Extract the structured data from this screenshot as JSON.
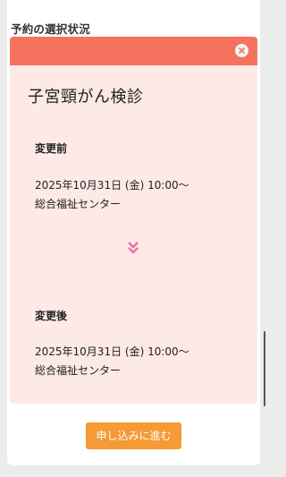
{
  "selection": {
    "section_title": "予約の選択状況",
    "close_icon": "close-icon",
    "exam_title": "子宮頸がん検診",
    "before": {
      "label": "変更前",
      "datetime": "2025年10月31日 (金) 10:00～",
      "location": "総合福祉センター"
    },
    "arrow_icon": "double-chevron-down-icon",
    "after": {
      "label": "変更後",
      "datetime": "2025年10月31日 (金) 10:00～",
      "location": "総合福祉センター"
    }
  },
  "actions": {
    "proceed_label": "申し込みに進む"
  },
  "colors": {
    "header": "#f5735e",
    "panel": "#fde9e6",
    "button": "#f59a35",
    "arrow": "#e86fa8"
  }
}
